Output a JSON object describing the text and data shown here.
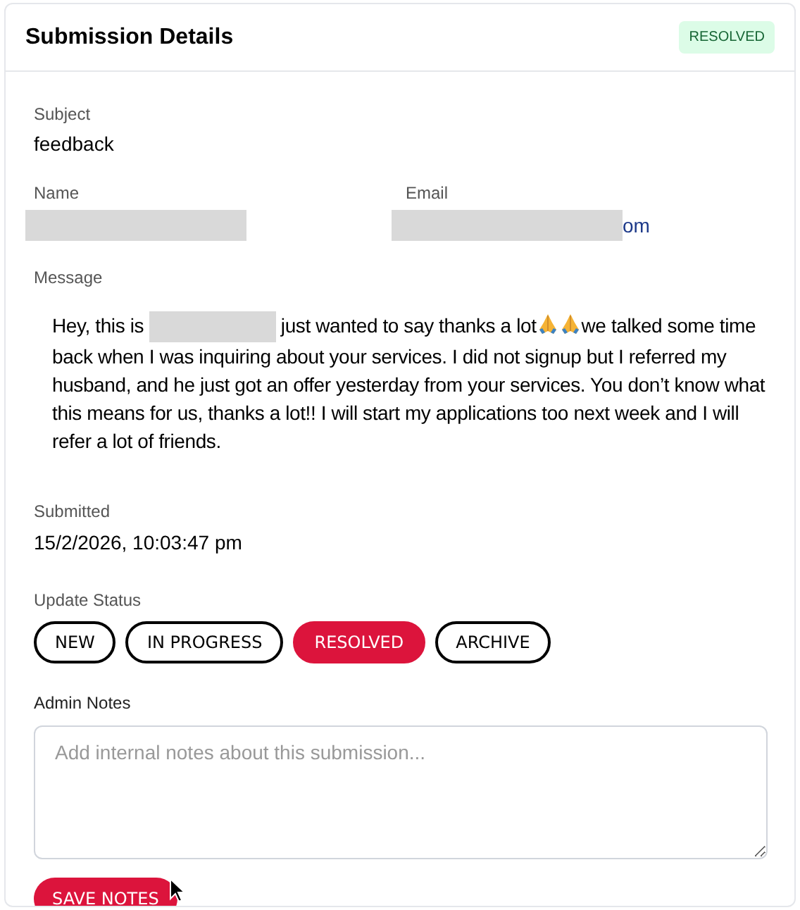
{
  "header": {
    "title": "Submission Details",
    "badge": "RESOLVED"
  },
  "subject": {
    "label": "Subject",
    "value": "feedback"
  },
  "name": {
    "label": "Name",
    "redacted": true
  },
  "email": {
    "label": "Email",
    "redacted": true,
    "value": "om"
  },
  "message": {
    "label": "Message",
    "parts": [
      {
        "kind": "text",
        "text": "Hey, this is "
      },
      {
        "kind": "redacted"
      },
      {
        "kind": "text",
        "text": " just wanted to say thanks a lot"
      },
      {
        "kind": "icon"
      },
      {
        "kind": "icon"
      },
      {
        "kind": "text",
        "text": "we talked some time back when I was inquiring about your services. I did not signup but I referred my husband, and he just got an offer yesterday from your services. You don’t know what this means for us, thanks a lot!! I will start my applications too next week and I will refer a lot of friends."
      }
    ]
  },
  "submitted": {
    "label": "Submitted",
    "value": "15/2/2026, 10:03:47 pm"
  },
  "status": {
    "label": "Update Status",
    "options": [
      {
        "label": "NEW",
        "selected": false
      },
      {
        "label": "IN PROGRESS",
        "selected": false
      },
      {
        "label": "RESOLVED",
        "selected": true
      },
      {
        "label": "ARCHIVE",
        "selected": false
      }
    ]
  },
  "notes": {
    "label": "Admin Notes",
    "placeholder": "Add internal notes about this submission..."
  },
  "save_button": "SAVE NOTES"
}
